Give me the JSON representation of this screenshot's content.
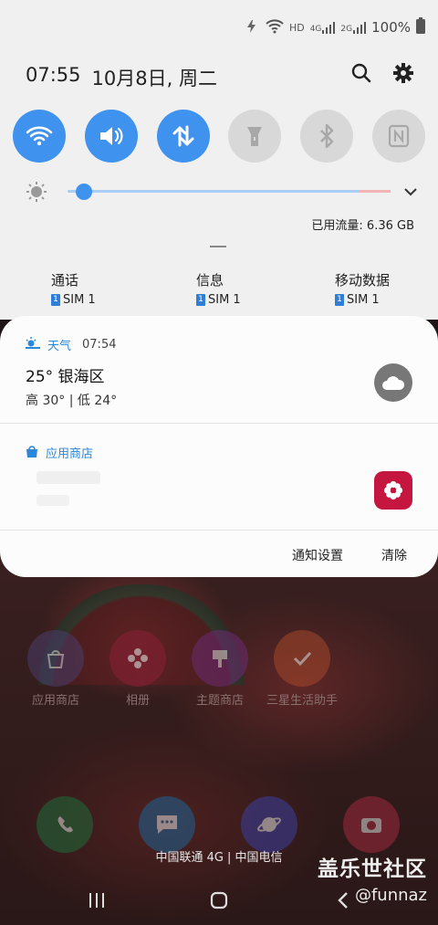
{
  "status_bar": {
    "network_labels": [
      "HD",
      "4G",
      "2G"
    ],
    "battery_percent": "100%"
  },
  "quick_panel": {
    "time": "07:55",
    "date": "10月8日, 周二",
    "tiles": [
      {
        "name": "wifi",
        "active": true
      },
      {
        "name": "sound",
        "active": true
      },
      {
        "name": "mobile-data",
        "active": true
      },
      {
        "name": "flashlight",
        "active": false
      },
      {
        "name": "bluetooth",
        "active": false
      },
      {
        "name": "nfc",
        "active": false
      }
    ],
    "brightness_level": 0.05,
    "data_usage": "已用流量: 6.36 GB",
    "sim_shortcuts": [
      {
        "title": "通话",
        "sim_index": "1",
        "sim_label": "SIM 1"
      },
      {
        "title": "信息",
        "sim_index": "1",
        "sim_label": "SIM 1"
      },
      {
        "title": "移动数据",
        "sim_index": "1",
        "sim_label": "SIM 1"
      }
    ]
  },
  "notifications": [
    {
      "app": "天气",
      "time": "07:54",
      "title": "25° 银海区",
      "text": "高 30° | 低 24°",
      "icon": "cloud-icon"
    },
    {
      "app": "应用商店",
      "icon": "gallery-flower-icon"
    }
  ],
  "notification_actions": {
    "settings": "通知设置",
    "clear": "清除"
  },
  "home_screen": {
    "apps_row1": [
      "应用商店",
      "相册",
      "主题商店",
      "三星生活助手"
    ],
    "carrier": "中国联通 4G | 中国电信"
  },
  "watermark": {
    "line1": "盖乐世社区",
    "line2": "@funnaz"
  },
  "colors": {
    "accent": "#3f92ee",
    "panel_bg": "#f0f0f0",
    "card_bg": "#fcfcfc",
    "gallery_red": "#c4163f"
  }
}
